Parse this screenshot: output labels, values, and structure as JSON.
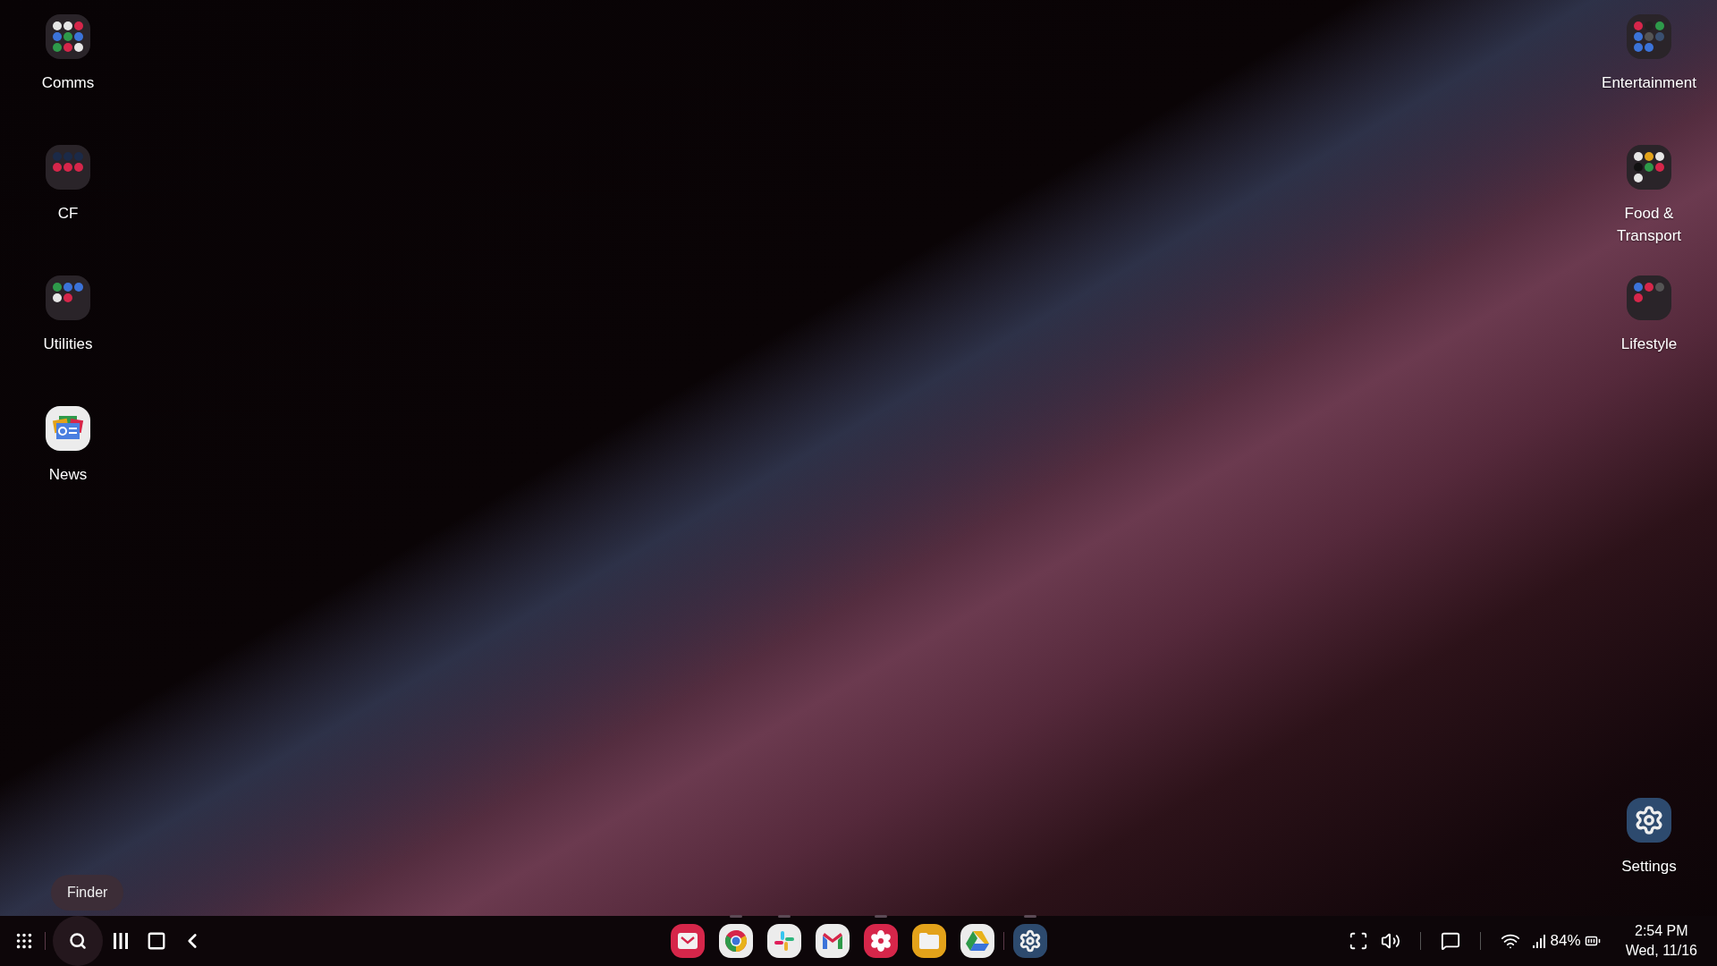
{
  "desktop": {
    "left_shortcuts": [
      {
        "label": "Comms",
        "kind": "folder"
      },
      {
        "label": "CF",
        "kind": "folder"
      },
      {
        "label": "Utilities",
        "kind": "folder"
      },
      {
        "label": "News",
        "kind": "news"
      }
    ],
    "right_shortcuts": [
      {
        "label": "Entertainment",
        "kind": "folder"
      },
      {
        "label": "Food & Transport",
        "kind": "folder"
      },
      {
        "label": "Lifestyle",
        "kind": "folder"
      }
    ],
    "bottom_shortcut": {
      "label": "Settings",
      "kind": "settings"
    }
  },
  "tooltip": {
    "text": "Finder"
  },
  "taskbar": {
    "nav_buttons": [
      {
        "kind": "apps",
        "highlighted": false
      },
      {
        "kind": "search",
        "highlighted": true
      },
      {
        "kind": "recents",
        "highlighted": false
      },
      {
        "kind": "home",
        "highlighted": false
      },
      {
        "kind": "back",
        "highlighted": false
      }
    ],
    "pinned_apps": [
      {
        "kind": "mail",
        "running": false
      },
      {
        "kind": "browser",
        "running": true
      },
      {
        "kind": "chat",
        "running": true
      },
      {
        "kind": "gmail",
        "running": false
      },
      {
        "kind": "gallery",
        "running": true
      },
      {
        "kind": "files",
        "running": false
      },
      {
        "kind": "drive",
        "running": false
      },
      {
        "kind": "settings",
        "running": true
      }
    ],
    "battery": "84%",
    "time": "2:54 PM",
    "date": "Wed, 11/16"
  }
}
